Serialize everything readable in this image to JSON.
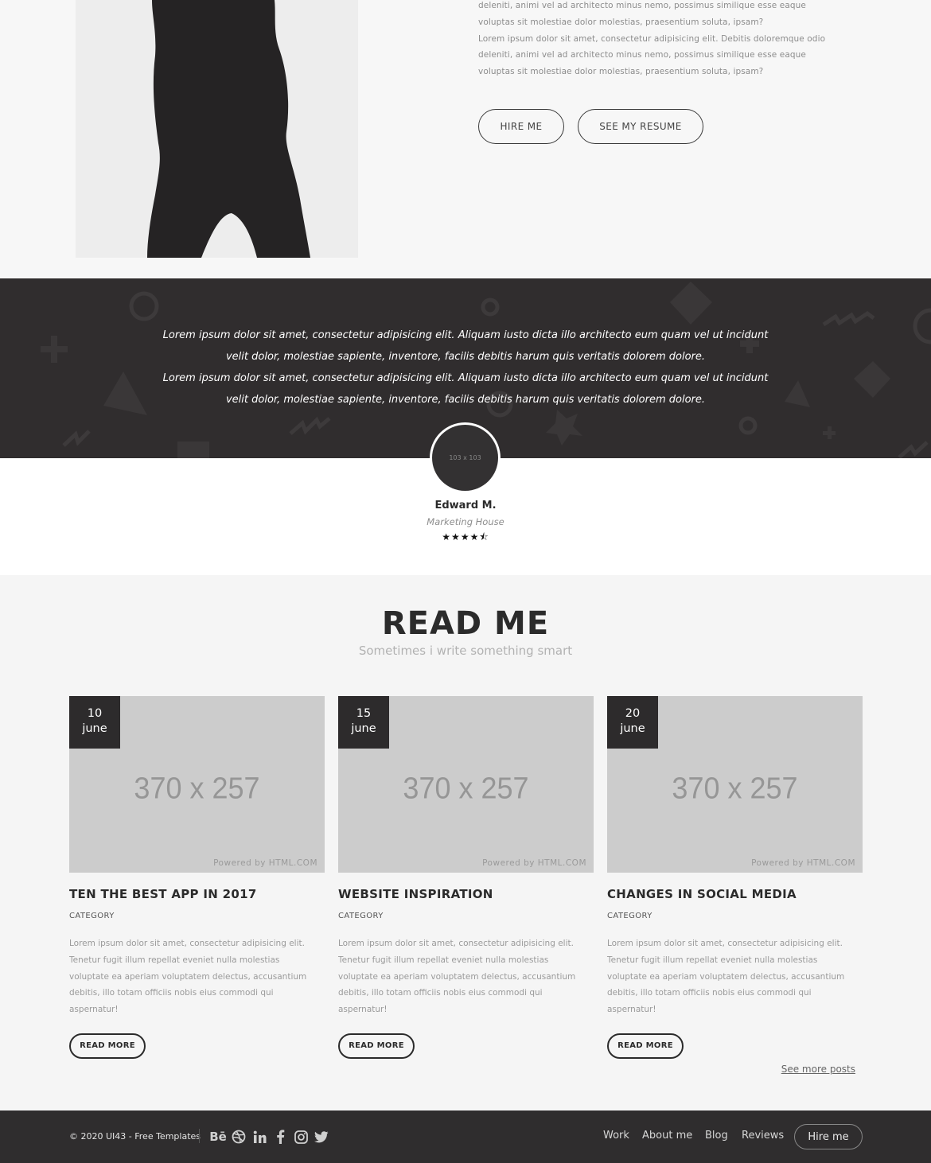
{
  "about": {
    "paragraphs": [
      "deleniti, animi vel ad architecto minus nemo, possimus similique esse eaque voluptas sit molestiae dolor molestias, praesentium soluta, ipsam?",
      "Lorem ipsum dolor sit amet, consectetur adipisicing elit. Debitis doloremque odio deleniti, animi vel ad architecto minus nemo, possimus similique esse eaque voluptas sit molestiae dolor molestias, praesentium soluta, ipsam?"
    ],
    "hire_label": "HIRE ME",
    "resume_label": "SEE MY RESUME"
  },
  "testimonial": {
    "quote_lines": [
      "Lorem ipsum dolor sit amet, consectetur adipisicing elit. Aliquam iusto dicta illo architecto eum quam vel ut incidunt",
      "velit dolor, molestiae sapiente, inventore, facilis debitis harum quis veritatis dolorem dolore.",
      "Lorem ipsum dolor sit amet, consectetur adipisicing elit. Aliquam iusto dicta illo architecto eum quam vel ut incidunt",
      "velit dolor, molestiae sapiente, inventore, facilis debitis harum quis veritatis dolorem dolore."
    ],
    "avatar_placeholder": "103 x 103",
    "name": "Edward M.",
    "company": "Marketing House",
    "rating": 4.5,
    "stars": "★★★★⯪"
  },
  "blog": {
    "title": "READ ME",
    "subtitle": "Sometimes i write something smart",
    "posts": [
      {
        "day": "10",
        "month": "june",
        "image_placeholder": "370 x 257",
        "powered": "Powered by HTML.COM",
        "title": "TEN THE BEST APP IN 2017",
        "category": "CATEGORY",
        "excerpt": "Lorem ipsum dolor sit amet, consectetur adipisicing elit. Tenetur fugit illum repellat eveniet nulla molestias voluptate ea aperiam voluptatem delectus, accusantium debitis, illo totam officiis nobis eius commodi qui aspernatur!",
        "read_more": "READ MORE"
      },
      {
        "day": "15",
        "month": "june",
        "image_placeholder": "370 x 257",
        "powered": "Powered by HTML.COM",
        "title": "WEBSITE INSPIRATION",
        "category": "CATEGORY",
        "excerpt": "Lorem ipsum dolor sit amet, consectetur adipisicing elit. Tenetur fugit illum repellat eveniet nulla molestias voluptate ea aperiam voluptatem delectus, accusantium debitis, illo totam officiis nobis eius commodi qui aspernatur!",
        "read_more": "READ MORE"
      },
      {
        "day": "20",
        "month": "june",
        "image_placeholder": "370 x 257",
        "powered": "Powered by HTML.COM",
        "title": "CHANGES IN SOCIAL MEDIA",
        "category": "CATEGORY",
        "excerpt": "Lorem ipsum dolor sit amet, consectetur adipisicing elit. Tenetur fugit illum repellat eveniet nulla molestias voluptate ea aperiam voluptatem delectus, accusantium debitis, illo totam officiis nobis eius commodi qui aspernatur!",
        "read_more": "READ MORE"
      }
    ],
    "see_more": "See more posts"
  },
  "footer": {
    "copyright": "© 2020 UI43 - Free Templates",
    "social_icons": [
      "behance-icon",
      "dribbble-icon",
      "linkedin-icon",
      "facebook-icon",
      "instagram-icon",
      "twitter-icon"
    ],
    "behance_glyph": "Bē",
    "nav": [
      "Work",
      "About me",
      "Blog",
      "Reviews"
    ],
    "hire_label": "Hire me"
  },
  "colors": {
    "dark": "#2f2d2e",
    "light_bg": "#f6f6f6",
    "placeholder_gray": "#cccccc"
  }
}
